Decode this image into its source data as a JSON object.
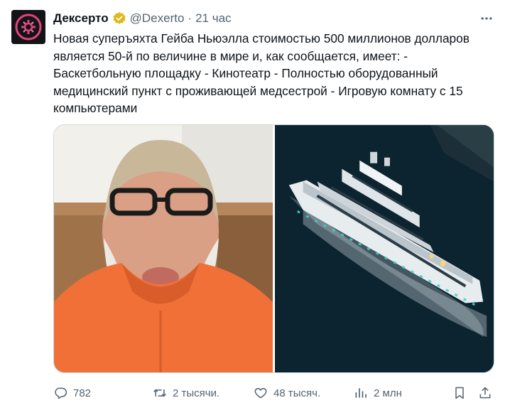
{
  "tweet": {
    "author": {
      "display_name": "Дексерто",
      "handle": "@Dexerto",
      "verified_badge": "gold-verified-badge",
      "avatar_icon": "dexerto-logo"
    },
    "separator": "·",
    "time": "21 час",
    "text": "Новая суперъяхта Гейба Ньюэлла стоимостью 500 миллионов долларов является 50-й по величине в мире и, как сообщается, имеет: - Баскетбольную площадку - Кинотеатр - Полностью оборудованный медицинский пункт с проживающей медсестрой - Игровую комнату с 15 компьютерами",
    "media": [
      {
        "kind": "photo",
        "subject": "man-with-glasses-orange-shirt"
      },
      {
        "kind": "photo",
        "subject": "superyacht-at-sea"
      }
    ],
    "metrics": {
      "replies": "782",
      "retweets": "2 тысячи.",
      "likes": "48 тысяч.",
      "views": "2 млн"
    },
    "colors": {
      "text": "#0f1419",
      "secondary": "#536471",
      "verified": "#e2b719",
      "avatar_accent": "#e0457b"
    }
  }
}
